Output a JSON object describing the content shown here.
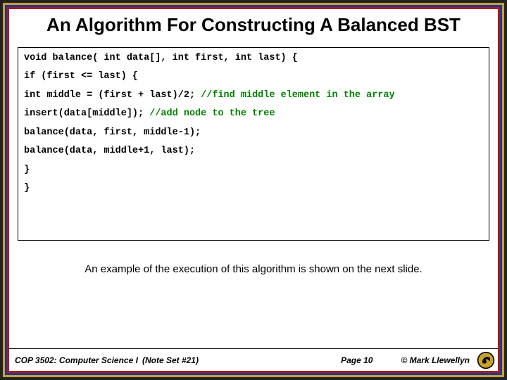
{
  "title": "An Algorithm For Constructing A Balanced BST",
  "code": {
    "l1": "void balance( int data[], int first, int last) {",
    "l2": "   if (first <= last) {",
    "l3a": "      int middle = (first + last)/2; ",
    "l3c": "//find middle element in the array",
    "l4a": "      insert(data[middle]);   ",
    "l4c": "//add node to the tree",
    "l5": "      balance(data, first, middle-1);",
    "l6": "      balance(data, middle+1, last);",
    "l7": "   }",
    "l8": "}"
  },
  "caption": "An example of the execution of this algorithm is shown on the next slide.",
  "footer": {
    "course": "COP 3502: Computer Science I",
    "note": "(Note Set #21)",
    "page": "Page 10",
    "copy": "© Mark Llewellyn"
  }
}
